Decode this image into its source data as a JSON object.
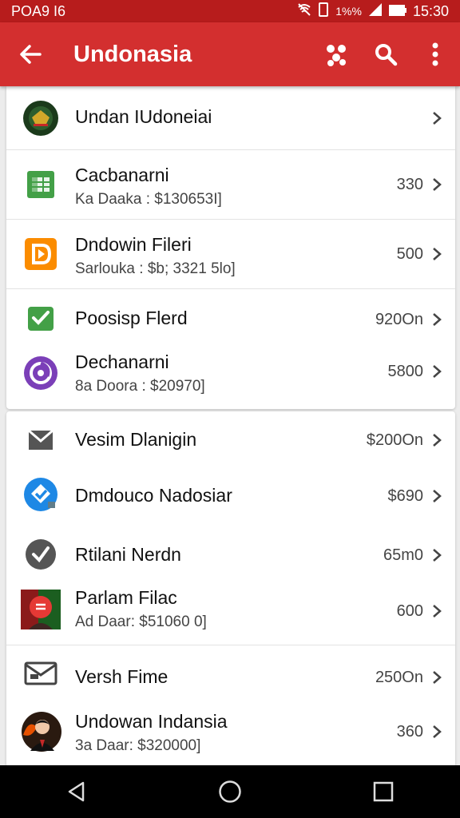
{
  "status_bar": {
    "left_text": "POA9 I6",
    "battery_text": "1%%",
    "time": "15:30"
  },
  "app_bar": {
    "title": "Undonasia"
  },
  "card1": [
    {
      "title": "Undan IUdoneiai",
      "subtitle": "",
      "value": ""
    },
    {
      "title": "Cacbanarni",
      "subtitle": "Ka Daaka : $130653I]",
      "value": "330"
    },
    {
      "title": "Dndowin Fileri",
      "subtitle": "Sarlouka : $b; 3321 5lo]",
      "value": "500"
    },
    {
      "title": "Poosisp Flerd",
      "subtitle": "",
      "value": "920On"
    },
    {
      "title": "Dechanarni",
      "subtitle": "8a Doora : $20970]",
      "value": "5800"
    }
  ],
  "card2": [
    {
      "title": "Vesim Dlanigin",
      "subtitle": "",
      "value": "$200On"
    },
    {
      "title": "Dmdouco Nadosiar",
      "subtitle": "",
      "value": "$690"
    },
    {
      "title": "Rtilani Nerdn",
      "subtitle": "",
      "value": "65m0"
    },
    {
      "title": "Parlam Filac",
      "subtitle": "Ad Daar: $51060 0]",
      "value": "600"
    },
    {
      "title": "Versh Fime",
      "subtitle": "",
      "value": "250On"
    },
    {
      "title": "Undowan Indansia",
      "subtitle": "3a Daar: $320000]",
      "value": "360"
    }
  ],
  "colors": {
    "status_bar": "#b71c1c",
    "app_bar": "#d32f2f"
  },
  "icons": {
    "card1": [
      "indonesia-emblem-icon",
      "spreadsheet-icon",
      "play-file-icon",
      "check-badge-icon",
      "swirl-logo-icon"
    ],
    "card2": [
      "mail-icon",
      "shield-check-icon",
      "check-circle-icon",
      "avatar-icon",
      "envelope-icon",
      "avatar-icon"
    ]
  }
}
